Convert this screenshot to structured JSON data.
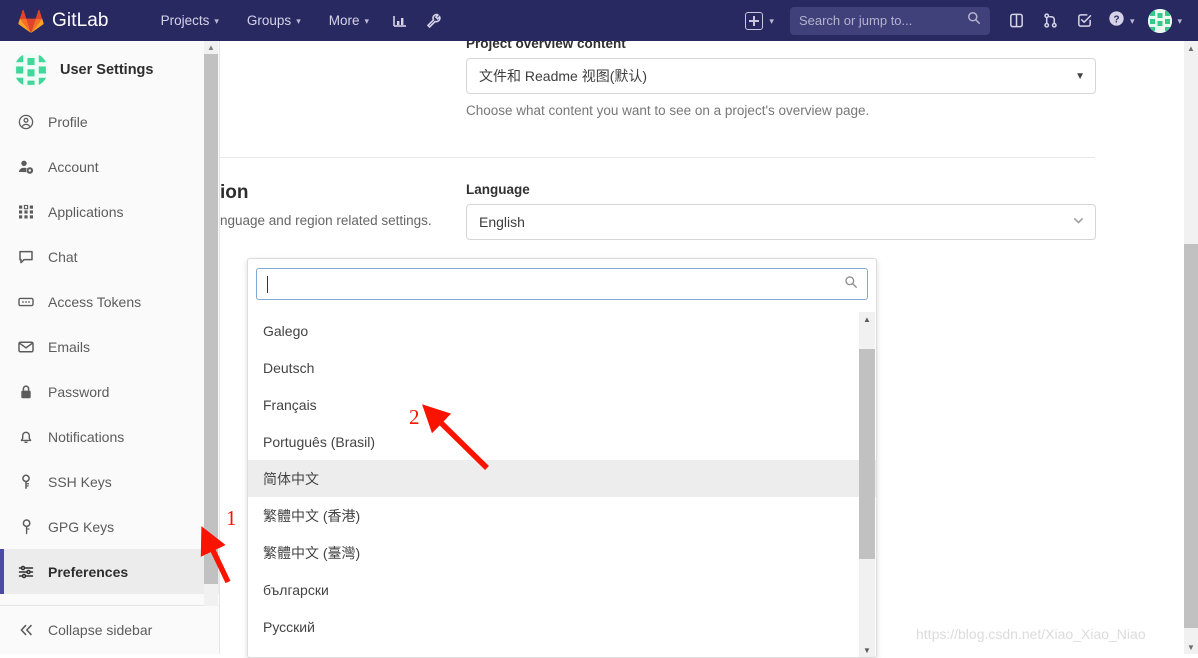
{
  "navbar": {
    "brand": "GitLab",
    "logo_icon": "gitlab-fox-logo",
    "links": [
      {
        "label": "Projects",
        "icon": "chevron-down-icon"
      },
      {
        "label": "Groups",
        "icon": "chevron-down-icon"
      },
      {
        "label": "More",
        "icon": "chevron-down-icon"
      }
    ],
    "icons": [
      {
        "name": "analytics-chart-icon"
      },
      {
        "name": "wrench-icon"
      }
    ],
    "new_menu": {
      "icon": "plus-square-icon",
      "caret": "chevron-down-icon"
    },
    "search": {
      "placeholder": "Search or jump to...",
      "value": "",
      "icon": "search-icon"
    },
    "right_icons": [
      {
        "name": "issues-icon"
      },
      {
        "name": "merge-requests-icon"
      },
      {
        "name": "todos-icon"
      },
      {
        "name": "help-icon",
        "caret": "chevron-down-icon"
      }
    ],
    "user": {
      "avatar": "user-avatar-identicon",
      "caret": "chevron-down-icon"
    }
  },
  "sidebar": {
    "title": "User Settings",
    "avatar_icon": "user-avatar-identicon",
    "items": [
      {
        "label": "Profile",
        "icon": "user-circle-icon",
        "active": false
      },
      {
        "label": "Account",
        "icon": "account-gear-icon",
        "active": false
      },
      {
        "label": "Applications",
        "icon": "grid-apps-icon",
        "active": false
      },
      {
        "label": "Chat",
        "icon": "chat-bubble-icon",
        "active": false
      },
      {
        "label": "Access Tokens",
        "icon": "token-icon",
        "active": false
      },
      {
        "label": "Emails",
        "icon": "envelope-icon",
        "active": false
      },
      {
        "label": "Password",
        "icon": "lock-icon",
        "active": false
      },
      {
        "label": "Notifications",
        "icon": "bell-icon",
        "active": false
      },
      {
        "label": "SSH Keys",
        "icon": "key-icon",
        "active": false
      },
      {
        "label": "GPG Keys",
        "icon": "key-icon",
        "active": false
      },
      {
        "label": "Preferences",
        "icon": "sliders-icon",
        "active": true
      }
    ],
    "collapse": {
      "label": "Collapse sidebar",
      "icon": "double-chevron-left-icon"
    },
    "scrollbar": {
      "up_icon": "triangle-up-icon",
      "down_icon": "triangle-down-icon"
    }
  },
  "main": {
    "behavior_section": {
      "field_label": "Project overview content",
      "select_value": "文件和 Readme 视图(默认)",
      "select_caret": "caret-down-icon",
      "help_text": "Choose what content you want to see on a project's overview page."
    },
    "localization_section": {
      "title": "ion",
      "description": "nguage and region related settings.",
      "field_label": "Language",
      "select_value": "English",
      "select_caret": "chevron-down-icon"
    }
  },
  "dropdown": {
    "search": {
      "value": "",
      "placeholder": "",
      "icon": "search-icon"
    },
    "items": [
      {
        "label": "Galego",
        "highlighted": false
      },
      {
        "label": "Deutsch",
        "highlighted": false
      },
      {
        "label": "Français",
        "highlighted": false
      },
      {
        "label": "Português (Brasil)",
        "highlighted": false
      },
      {
        "label": "简体中文",
        "highlighted": true
      },
      {
        "label": "繁體中文 (香港)",
        "highlighted": false
      },
      {
        "label": "繁體中文 (臺灣)",
        "highlighted": false
      },
      {
        "label": "български",
        "highlighted": false
      },
      {
        "label": "Русский",
        "highlighted": false
      }
    ],
    "scrollbar": {
      "up_icon": "triangle-up-icon",
      "down_icon": "triangle-down-icon"
    }
  },
  "window_scrollbar": {
    "up_icon": "triangle-up-icon",
    "down_icon": "triangle-down-icon"
  },
  "annotations": [
    {
      "label": "1",
      "color": "#fa1400"
    },
    {
      "label": "2",
      "color": "#fa1400"
    }
  ],
  "watermark": "https://blog.csdn.net/Xiao_Xiao_Niao"
}
